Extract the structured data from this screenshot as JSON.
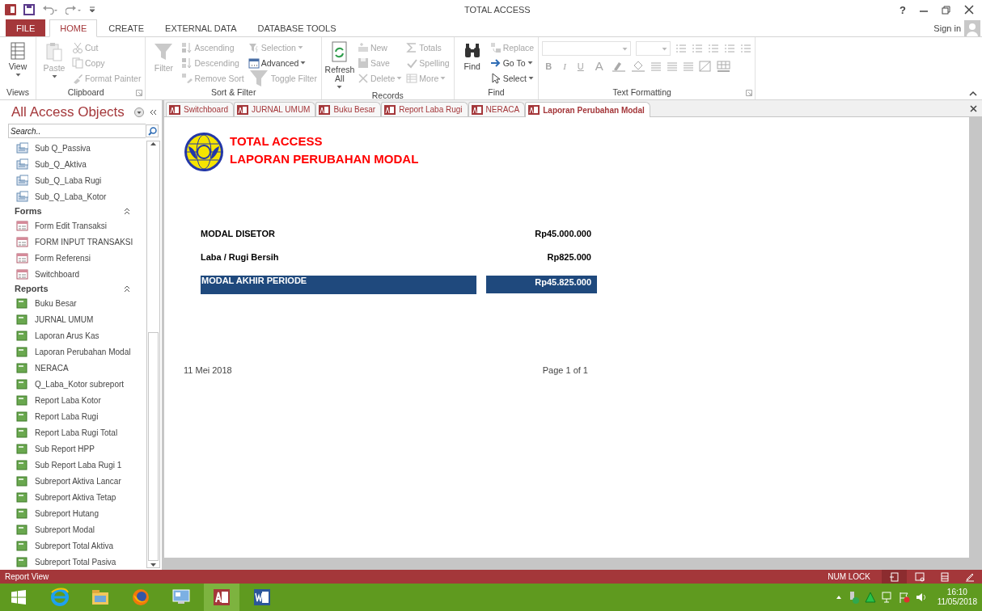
{
  "window": {
    "title": "TOTAL ACCESS",
    "help": "?",
    "sign_in": "Sign in"
  },
  "ribbon_tabs": [
    {
      "label": "FILE",
      "kind": "file",
      "selected": false
    },
    {
      "label": "HOME",
      "kind": "tab",
      "selected": true
    },
    {
      "label": "CREATE",
      "kind": "tab",
      "selected": false
    },
    {
      "label": "EXTERNAL DATA",
      "kind": "tab",
      "selected": false
    },
    {
      "label": "DATABASE TOOLS",
      "kind": "tab",
      "selected": false
    }
  ],
  "ribbon_groups": [
    {
      "label": "Views",
      "large": [
        {
          "label": "View",
          "disabled": false,
          "dropdown": true
        }
      ]
    },
    {
      "label": "Clipboard",
      "launcher": true,
      "large": [
        {
          "label": "Paste",
          "disabled": true,
          "dropdown": true
        }
      ],
      "columns": [
        [
          {
            "label": "Cut",
            "disabled": true,
            "dropdown": false
          },
          {
            "label": "Copy",
            "disabled": true,
            "dropdown": false
          },
          {
            "label": "Format Painter",
            "disabled": true,
            "dropdown": false
          }
        ]
      ]
    },
    {
      "label": "Sort & Filter",
      "large": [
        {
          "label": "Filter",
          "disabled": true,
          "dropdown": false
        }
      ],
      "columns": [
        [
          {
            "label": "Ascending",
            "disabled": true,
            "dropdown": false
          },
          {
            "label": "Descending",
            "disabled": true,
            "dropdown": false
          },
          {
            "label": "Remove Sort",
            "disabled": true,
            "dropdown": false
          }
        ],
        [
          {
            "label": "Selection",
            "disabled": true,
            "dropdown": true
          },
          {
            "label": "Advanced",
            "disabled": false,
            "dropdown": true
          },
          {
            "label": "Toggle Filter",
            "disabled": true,
            "dropdown": false
          }
        ]
      ]
    },
    {
      "label": "Records",
      "large": [
        {
          "label": "Refresh All",
          "disabled": false,
          "dropdown": true
        }
      ],
      "columns": [
        [
          {
            "label": "New",
            "disabled": true,
            "dropdown": false
          },
          {
            "label": "Save",
            "disabled": true,
            "dropdown": false
          },
          {
            "label": "Delete",
            "disabled": true,
            "dropdown": true
          }
        ],
        [
          {
            "label": "Totals",
            "disabled": true,
            "dropdown": false
          },
          {
            "label": "Spelling",
            "disabled": true,
            "dropdown": false
          },
          {
            "label": "More",
            "disabled": true,
            "dropdown": true
          }
        ]
      ]
    },
    {
      "label": "Find",
      "large": [
        {
          "label": "Find",
          "disabled": false,
          "dropdown": false
        }
      ],
      "columns": [
        [
          {
            "label": "Replace",
            "disabled": true,
            "dropdown": false
          },
          {
            "label": "Go To",
            "disabled": false,
            "dropdown": true
          },
          {
            "label": "Select",
            "disabled": false,
            "dropdown": true
          }
        ]
      ]
    }
  ],
  "text_formatting": {
    "label": "Text Formatting",
    "launcher": true,
    "disabled": true,
    "buttons": [
      "B",
      "I",
      "U",
      "A"
    ]
  },
  "nav": {
    "title": "All Access Objects",
    "search_placeholder": "Search..",
    "groups": [
      {
        "kind": "query",
        "items": [
          "Sub Q_Passiva",
          "Sub_Q_Aktiva",
          "Sub_Q_Laba Rugi",
          "Sub_Q_Laba_Kotor"
        ]
      },
      {
        "kind": "form",
        "heading": "Forms",
        "items": [
          "Form Edit Transaksi",
          "FORM INPUT TRANSAKSI",
          "Form Referensi",
          "Switchboard"
        ]
      },
      {
        "kind": "report",
        "heading": "Reports",
        "items": [
          "Buku Besar",
          "JURNAL UMUM",
          "Laporan Arus Kas",
          "Laporan Perubahan Modal",
          "NERACA",
          "Q_Laba_Kotor subreport",
          "Report Laba Kotor",
          "Report Laba Rugi",
          "Report Laba Rugi Total",
          "Sub Report HPP",
          "Sub Report Laba Rugi 1",
          "Subreport Aktiva Lancar",
          "Subreport Aktiva Tetap",
          "Subreport Hutang",
          "Subreport Modal",
          "Subreport Total Aktiva",
          "Subreport Total Pasiva"
        ]
      }
    ]
  },
  "doc_tabs": [
    {
      "label": "Switchboard",
      "selected": false
    },
    {
      "label": "JURNAL UMUM",
      "selected": false
    },
    {
      "label": "Buku Besar",
      "selected": false
    },
    {
      "label": "Report Laba Rugi",
      "selected": false
    },
    {
      "label": "NERACA",
      "selected": false
    },
    {
      "label": "Laporan Perubahan Modal",
      "selected": true
    }
  ],
  "report": {
    "title": "TOTAL ACCESS",
    "subtitle": "LAPORAN PERUBAHAN MODAL",
    "rows": [
      {
        "label": "MODAL DISETOR",
        "value": "Rp45.000.000",
        "kind": "plain"
      },
      {
        "label": "Laba / Rugi Bersih",
        "value": "Rp825.000",
        "kind": "plain"
      },
      {
        "label": "MODAL AKHIR PERIODE",
        "value": "Rp45.825.000",
        "kind": "total"
      }
    ],
    "date": "11 Mei 2018",
    "page": "Page 1 of 1"
  },
  "status_bar": {
    "mode": "Report View",
    "num_lock": "NUM LOCK",
    "views": [
      {
        "selected": true
      },
      {
        "selected": false
      },
      {
        "selected": false
      },
      {
        "selected": false
      }
    ]
  },
  "taskbar": {
    "apps": [
      {
        "selected": false
      },
      {
        "selected": false
      },
      {
        "selected": false
      },
      {
        "selected": false
      },
      {
        "selected": true
      },
      {
        "selected": false
      }
    ],
    "time": "16:10",
    "date": "11/05/2018"
  }
}
